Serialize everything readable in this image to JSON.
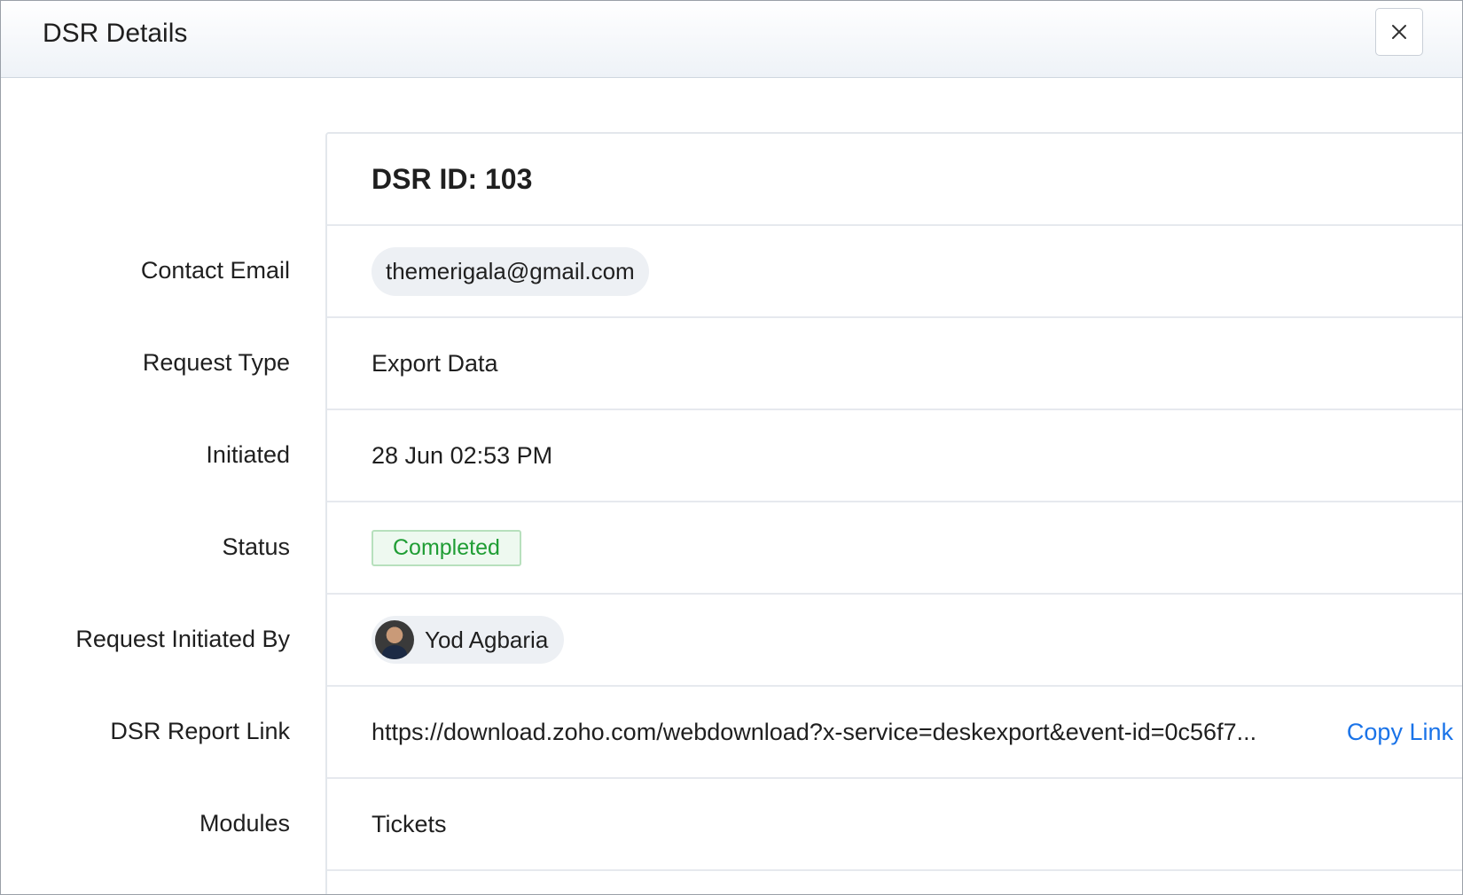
{
  "header": {
    "title": "DSR Details"
  },
  "panel": {
    "dsr_id": "DSR ID: 103",
    "fields": {
      "contact_email": {
        "label": "Contact Email",
        "value": "themerigala@gmail.com"
      },
      "request_type": {
        "label": "Request Type",
        "value": "Export Data"
      },
      "initiated": {
        "label": "Initiated",
        "value": "28 Jun 02:53 PM"
      },
      "status": {
        "label": "Status",
        "value": "Completed"
      },
      "initiated_by": {
        "label": "Request Initiated By",
        "value": "Yod Agbaria"
      },
      "report_link": {
        "label": "DSR Report Link",
        "value": "https://download.zoho.com/webdownload?x-service=deskexport&event-id=0c56f7...",
        "copy_label": "Copy Link"
      },
      "modules": {
        "label": "Modules",
        "value": "Tickets"
      }
    }
  },
  "colors": {
    "status_text": "#1f9d34",
    "status_bg": "#eef9f0",
    "link": "#1a73e8"
  },
  "icons": {
    "close": "close-icon"
  }
}
